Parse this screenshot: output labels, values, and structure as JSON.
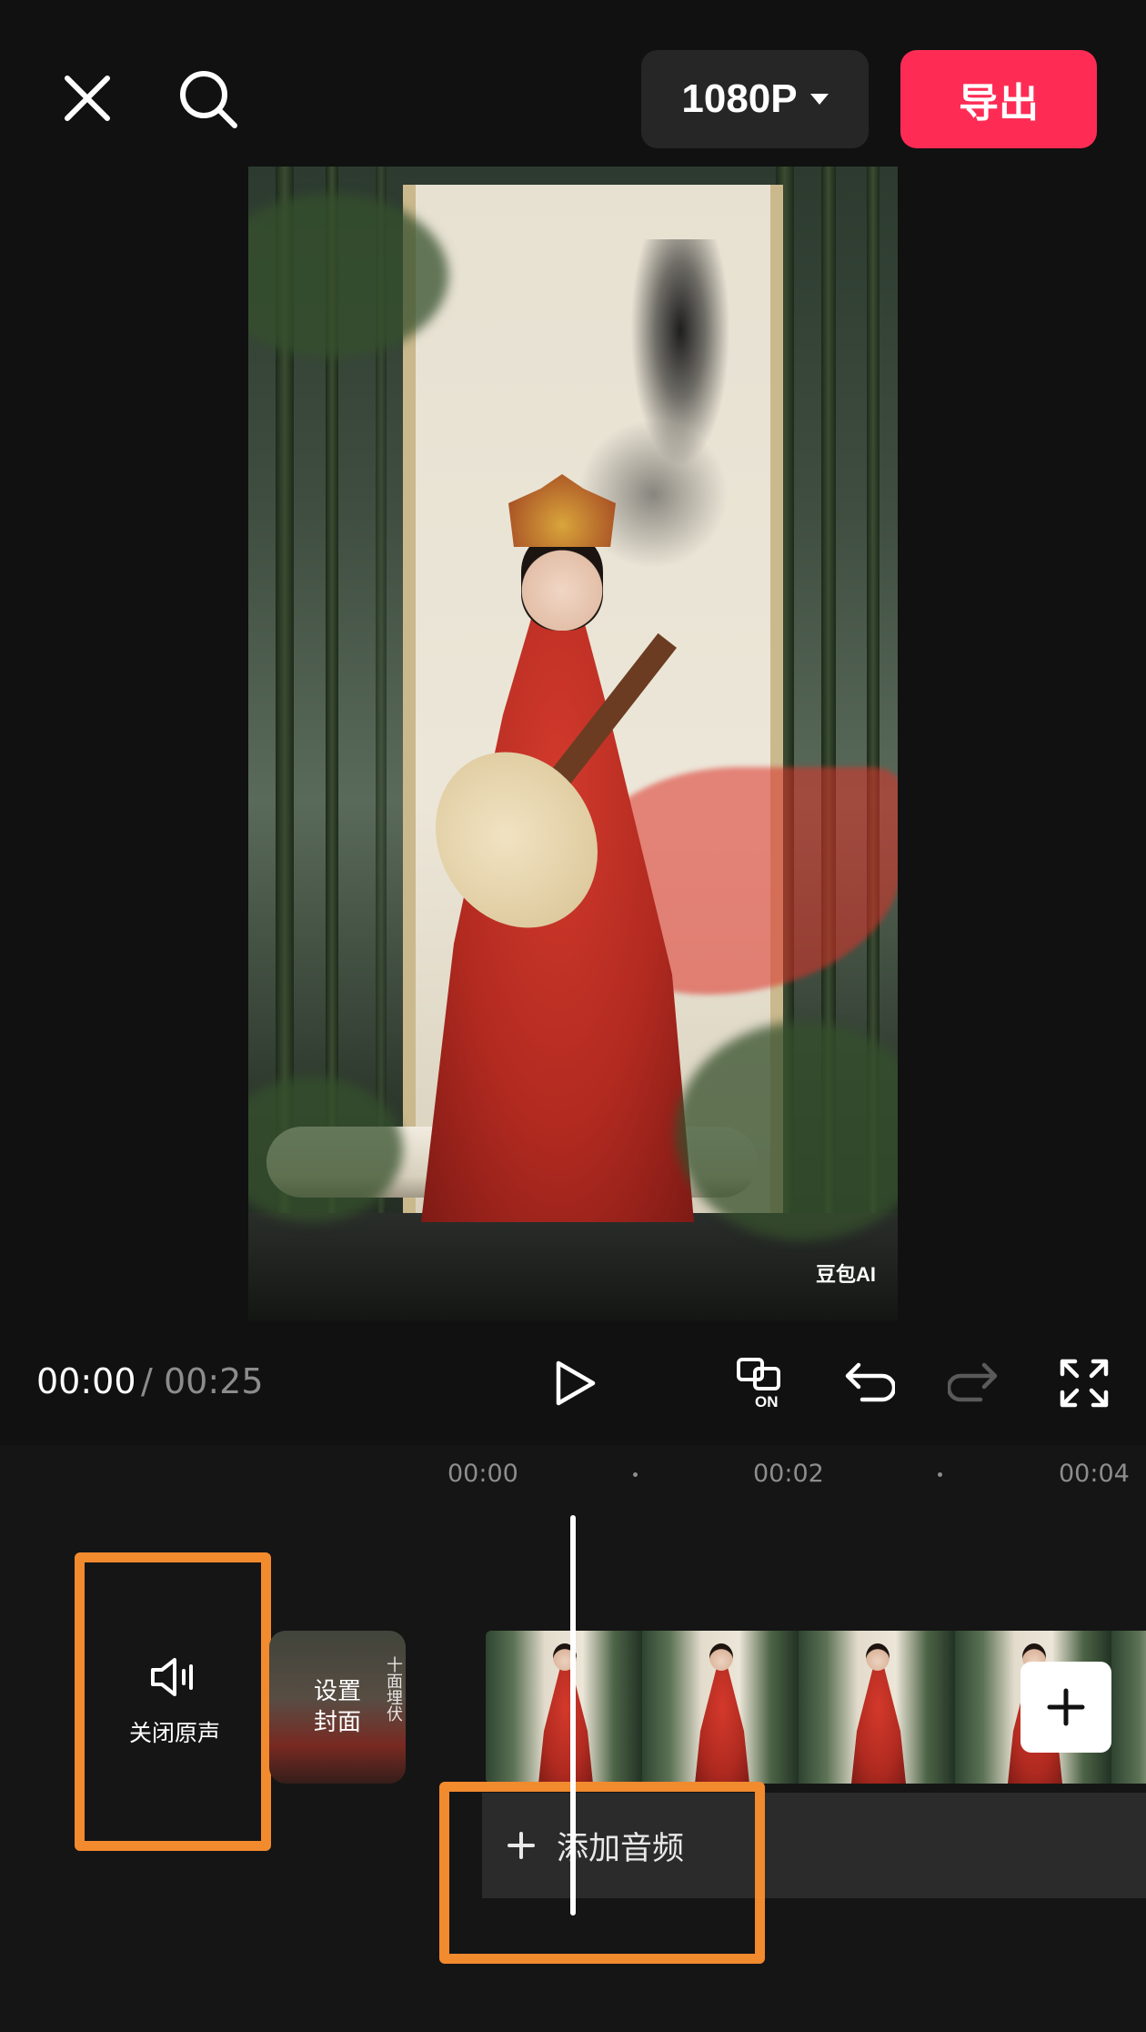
{
  "top_bar": {
    "close_icon": "close-icon",
    "search_icon": "search-icon",
    "resolution": "1080P",
    "export_label": "导出",
    "export_color": "#fe2c55"
  },
  "preview": {
    "watermark": "豆包AI",
    "scene": "Woman in red hanfu playing pipa in bamboo forest before a calligraphy scroll"
  },
  "playback": {
    "current_time": "00:00",
    "separator": "/",
    "total_time": "00:25",
    "controls": [
      "play-icon",
      "original-sound-on-icon",
      "undo-icon",
      "redo-icon",
      "fullscreen-icon"
    ]
  },
  "timeline": {
    "ruler": [
      "00:00",
      "00:02",
      "00:04"
    ],
    "mute_label": "关闭原声",
    "cover_label_line1": "设置",
    "cover_label_line2": "封面",
    "cover_side_text": "十面埋伏",
    "add_audio_label": "添加音频",
    "highlight_color": "#f28a2e"
  }
}
